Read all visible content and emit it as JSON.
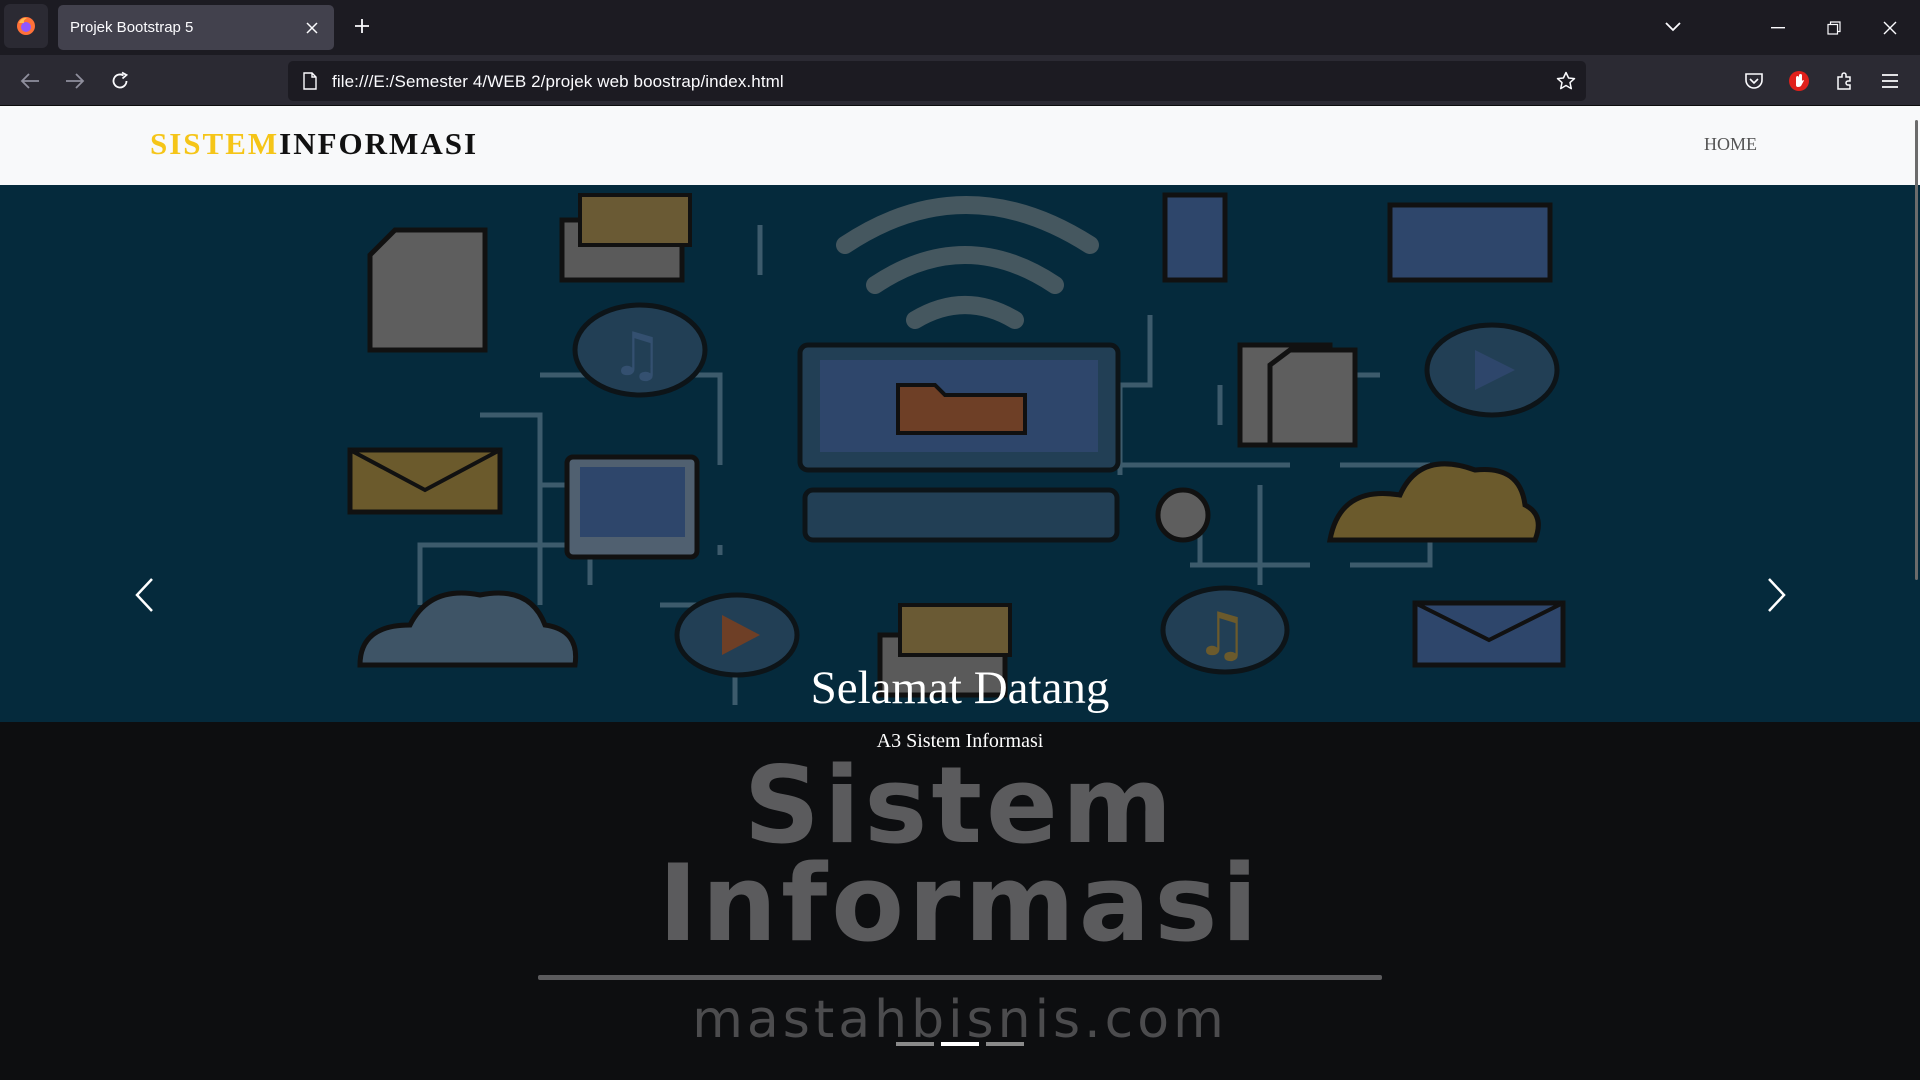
{
  "browser": {
    "tab_title": "Projek Bootstrap 5",
    "url": "file:///E:/Semester 4/WEB 2/projek web boostrap/index.html",
    "icons": [
      "firefox-icon",
      "close-icon",
      "plus-icon",
      "chevron-down-icon",
      "minimize-icon",
      "restore-icon",
      "close-window-icon",
      "back-icon",
      "forward-icon",
      "reload-icon",
      "page-icon",
      "star-icon",
      "pocket-icon",
      "extension-red-icon",
      "puzzle-icon",
      "menu-icon"
    ]
  },
  "site": {
    "brand_part1": "SISTEM",
    "brand_part2": "INFORMASI",
    "nav_home": "HOME",
    "colors": {
      "brand_accent": "#f5c518",
      "brand_dark": "#111111",
      "header_bg": "#f8f9fa"
    }
  },
  "carousel": {
    "caption_title": "Selamat Datang",
    "caption_subtitle": "A3 Sistem Informasi",
    "background_text_line1": "Sistem",
    "background_text_line2": "Informasi",
    "background_domain": "mastahbisnis.com",
    "indicator_count": 3,
    "active_indicator": 2
  }
}
